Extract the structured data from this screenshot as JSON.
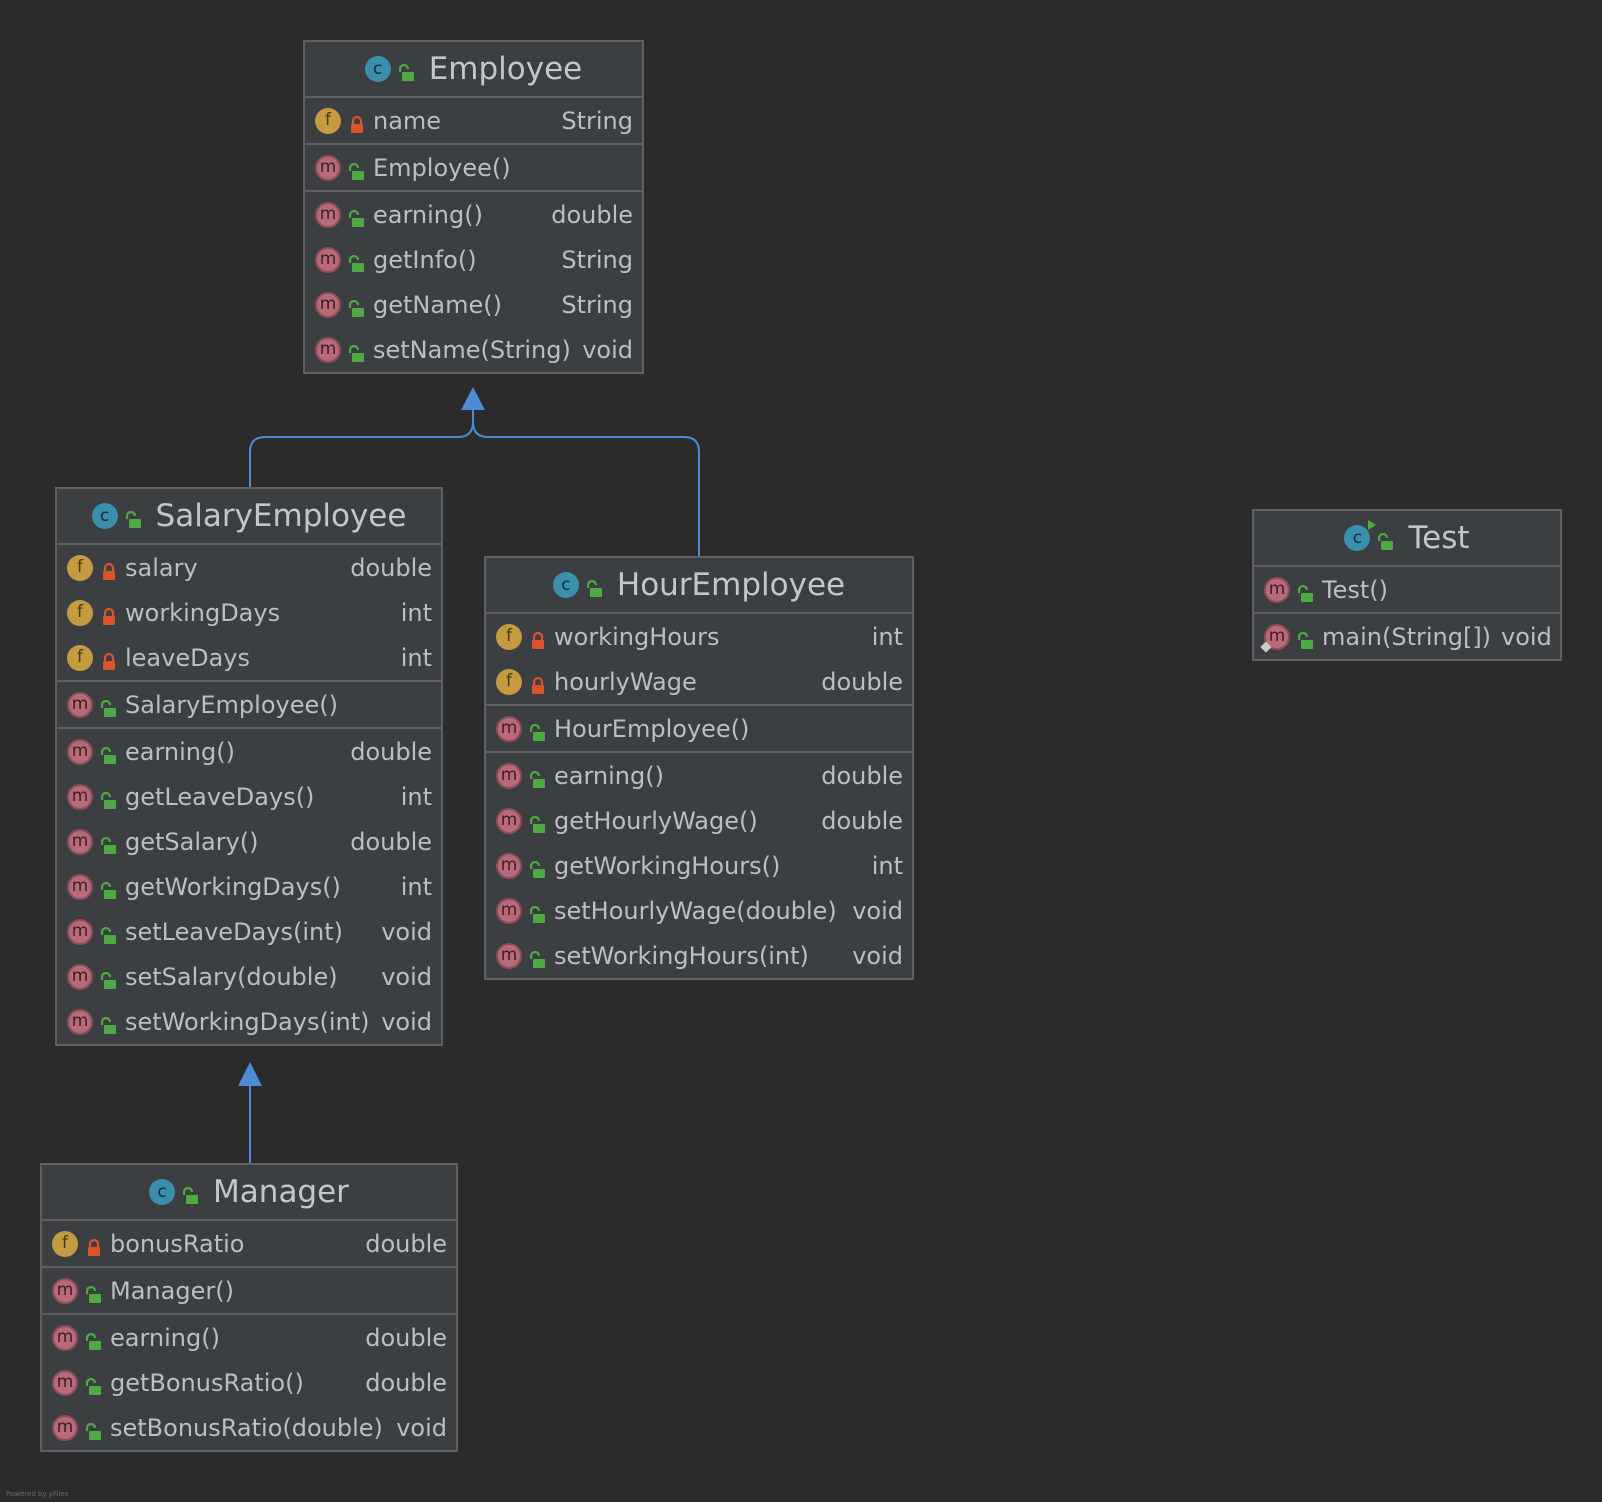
{
  "colors": {
    "background": "#2b2b2b",
    "node_fill": "#3c3f41",
    "node_border": "#5e6062",
    "edge": "#4d8bd6",
    "field_badge": "#c49b40",
    "method_badge": "#b86a78",
    "class_badge": "#3c8ead",
    "public_icon": "#4faa43",
    "private_icon": "#d9542b"
  },
  "classes": {
    "employee": {
      "title": "Employee",
      "icon": "class-icon",
      "fields": [
        {
          "name": "name",
          "type": "String"
        }
      ],
      "constructors": [
        {
          "name": "Employee()"
        }
      ],
      "methods": [
        {
          "name": "earning()",
          "type": "double"
        },
        {
          "name": "getInfo()",
          "type": "String"
        },
        {
          "name": "getName()",
          "type": "String"
        },
        {
          "name": "setName(String)",
          "type": "void"
        }
      ]
    },
    "salary_employee": {
      "title": "SalaryEmployee",
      "icon": "class-icon",
      "fields": [
        {
          "name": "salary",
          "type": "double"
        },
        {
          "name": "workingDays",
          "type": "int"
        },
        {
          "name": "leaveDays",
          "type": "int"
        }
      ],
      "constructors": [
        {
          "name": "SalaryEmployee()"
        }
      ],
      "methods": [
        {
          "name": "earning()",
          "type": "double"
        },
        {
          "name": "getLeaveDays()",
          "type": "int"
        },
        {
          "name": "getSalary()",
          "type": "double"
        },
        {
          "name": "getWorkingDays()",
          "type": "int"
        },
        {
          "name": "setLeaveDays(int)",
          "type": "void"
        },
        {
          "name": "setSalary(double)",
          "type": "void"
        },
        {
          "name": "setWorkingDays(int)",
          "type": "void"
        }
      ]
    },
    "hour_employee": {
      "title": "HourEmployee",
      "icon": "class-icon",
      "fields": [
        {
          "name": "workingHours",
          "type": "int"
        },
        {
          "name": "hourlyWage",
          "type": "double"
        }
      ],
      "constructors": [
        {
          "name": "HourEmployee()"
        }
      ],
      "methods": [
        {
          "name": "earning()",
          "type": "double"
        },
        {
          "name": "getHourlyWage()",
          "type": "double"
        },
        {
          "name": "getWorkingHours()",
          "type": "int"
        },
        {
          "name": "setHourlyWage(double)",
          "type": "void"
        },
        {
          "name": "setWorkingHours(int)",
          "type": "void"
        }
      ]
    },
    "manager": {
      "title": "Manager",
      "icon": "class-icon",
      "fields": [
        {
          "name": "bonusRatio",
          "type": "double"
        }
      ],
      "constructors": [
        {
          "name": "Manager()"
        }
      ],
      "methods": [
        {
          "name": "earning()",
          "type": "double"
        },
        {
          "name": "getBonusRatio()",
          "type": "double"
        },
        {
          "name": "setBonusRatio(double)",
          "type": "void"
        }
      ]
    },
    "test": {
      "title": "Test",
      "icon": "runnable-class-icon",
      "constructors": [
        {
          "name": "Test()"
        }
      ],
      "methods": [
        {
          "name": "main(String[])",
          "type": "void"
        }
      ]
    }
  },
  "relations": [
    {
      "from": "SalaryEmployee",
      "to": "Employee",
      "kind": "extends"
    },
    {
      "from": "HourEmployee",
      "to": "Employee",
      "kind": "extends"
    },
    {
      "from": "Manager",
      "to": "SalaryEmployee",
      "kind": "extends"
    }
  ],
  "footer": "Powered by yFiles"
}
